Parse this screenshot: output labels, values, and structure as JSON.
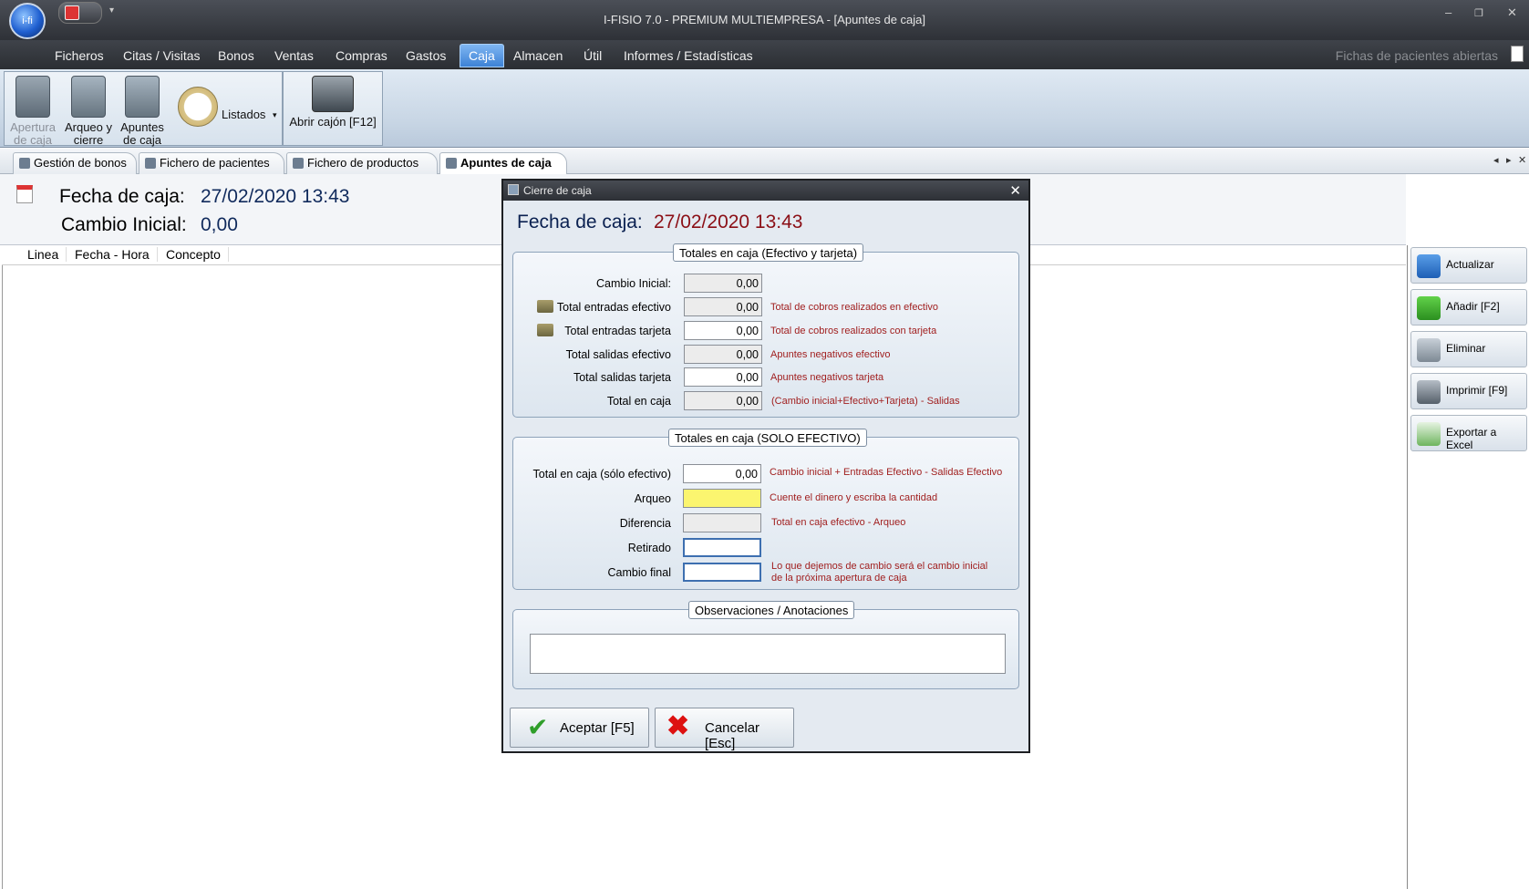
{
  "window": {
    "title": "I-FISIO 7.0 - PREMIUM MULTIEMPRESA - [Apuntes de caja]",
    "orb_label": "i-fi"
  },
  "menu": {
    "items": [
      "Ficheros",
      "Citas / Visitas",
      "Bonos",
      "Ventas",
      "Compras",
      "Gastos",
      "Caja",
      "Almacen",
      "Útil",
      "Informes / Estadísticas"
    ],
    "active": "Caja",
    "right_label": "Fichas de pacientes abiertas"
  },
  "ribbon": {
    "apertura": "Apertura de caja",
    "arqueo": "Arqueo y cierre",
    "apuntes": "Apuntes de caja",
    "listados": "Listados",
    "abrir_cajon": "Abrir cajón [F12]"
  },
  "tabs": [
    "Gestión de bonos",
    "Fichero de pacientes",
    "Fichero de productos",
    "Apuntes de caja"
  ],
  "page": {
    "fecha_label": "Fecha de caja:",
    "fecha_value": "27/02/2020 13:43",
    "cambio_label": "Cambio Inicial:",
    "cambio_value": "0,00",
    "columns": [
      "Linea",
      "Fecha - Hora",
      "Concepto"
    ]
  },
  "sidebar": {
    "actualizar": "Actualizar",
    "anadir": "Añadir [F2]",
    "eliminar": "Eliminar",
    "imprimir": "Imprimir [F9]",
    "exportar": "Exportar a Excel"
  },
  "dialog": {
    "title": "Cierre de caja",
    "fecha_label": "Fecha de caja:",
    "fecha_value": "27/02/2020 13:43",
    "group1": {
      "legend": "Totales en caja (Efectivo y tarjeta)",
      "rows": [
        {
          "label": "Cambio Inicial:",
          "value": "0,00",
          "hint": ""
        },
        {
          "label": "Total entradas efectivo",
          "value": "0,00",
          "hint": "Total de cobros realizados en efectivo"
        },
        {
          "label": "Total entradas tarjeta",
          "value": "0,00",
          "hint": "Total de cobros realizados con tarjeta"
        },
        {
          "label": "Total salidas efectivo",
          "value": "0,00",
          "hint": "Apuntes negativos efectivo"
        },
        {
          "label": "Total salidas tarjeta",
          "value": "0,00",
          "hint": "Apuntes negativos tarjeta"
        },
        {
          "label": "Total en caja",
          "value": "0,00",
          "hint": "(Cambio inicial+Efectivo+Tarjeta) - Salidas"
        }
      ]
    },
    "group2": {
      "legend": "Totales en caja (SOLO EFECTIVO)",
      "rows": [
        {
          "label": "Total en caja (sólo efectivo)",
          "value": "0,00",
          "hint": "Cambio inicial + Entradas Efectivo - Salidas Efectivo"
        },
        {
          "label": "Arqueo",
          "value": "",
          "hint": "Cuente el dinero y escriba la cantidad"
        },
        {
          "label": "Diferencia",
          "value": "",
          "hint": "Total en caja efectivo - Arqueo"
        },
        {
          "label": "Retirado",
          "value": "",
          "hint": ""
        },
        {
          "label": "Cambio final",
          "value": "",
          "hint": "Lo que dejemos de cambio será el cambio inicial de la próxima apertura de caja"
        }
      ]
    },
    "group3": {
      "legend": "Observaciones / Anotaciones",
      "value": ""
    },
    "aceptar": "Aceptar [F5]",
    "cancelar": "Cancelar [Esc]"
  }
}
